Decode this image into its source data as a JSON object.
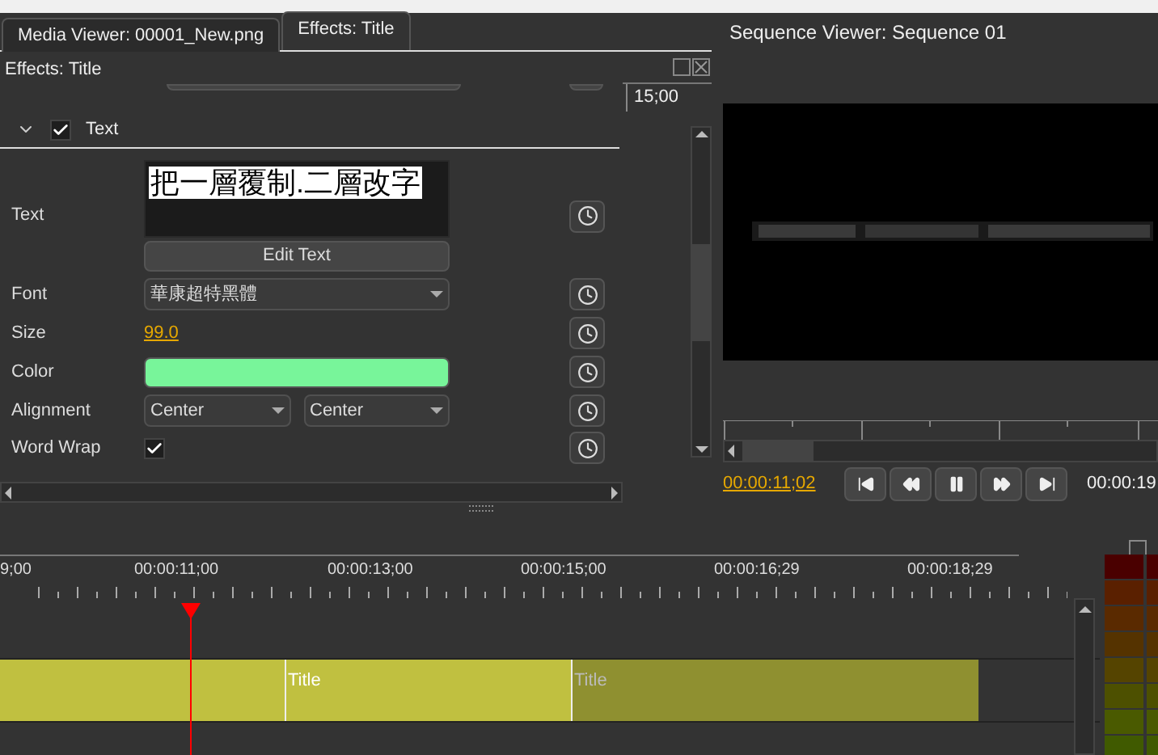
{
  "tabs": [
    {
      "label": "Media Viewer: 00001_New.png",
      "selected": false
    },
    {
      "label": "Effects: Title",
      "selected": true
    }
  ],
  "effects_panel": {
    "title": "Effects: Title",
    "section": {
      "label": "Text",
      "expanded": true,
      "checked": true
    },
    "rows": [
      {
        "kind": "text",
        "label": "Text",
        "value": "把一層覆制.二層改字",
        "button": "Edit Text"
      },
      {
        "kind": "dropdown",
        "label": "Font",
        "values": [
          "華康超特黑體"
        ]
      },
      {
        "kind": "number",
        "label": "Size",
        "value": "99.0"
      },
      {
        "kind": "color",
        "label": "Color",
        "color": "#78f59a"
      },
      {
        "kind": "dropdown",
        "label": "Alignment",
        "values": [
          "Center",
          "Center"
        ]
      },
      {
        "kind": "checkbox",
        "label": "Word Wrap",
        "checked": true
      }
    ],
    "keyframe_time": "15;00"
  },
  "sequence_viewer": {
    "title": "Sequence Viewer: Sequence 01",
    "current_time": "00:00:11;02",
    "end_time": "00:00:19"
  },
  "timeline": {
    "ruler": [
      "9;00",
      "00:00:11;00",
      "00:00:13;00",
      "00:00:15;00",
      "00:00:16;29",
      "00:00:18;29"
    ],
    "clips": [
      {
        "enabled": true
      },
      {
        "label": "Title",
        "enabled": true
      },
      {
        "label": "Title",
        "enabled": false
      }
    ]
  }
}
